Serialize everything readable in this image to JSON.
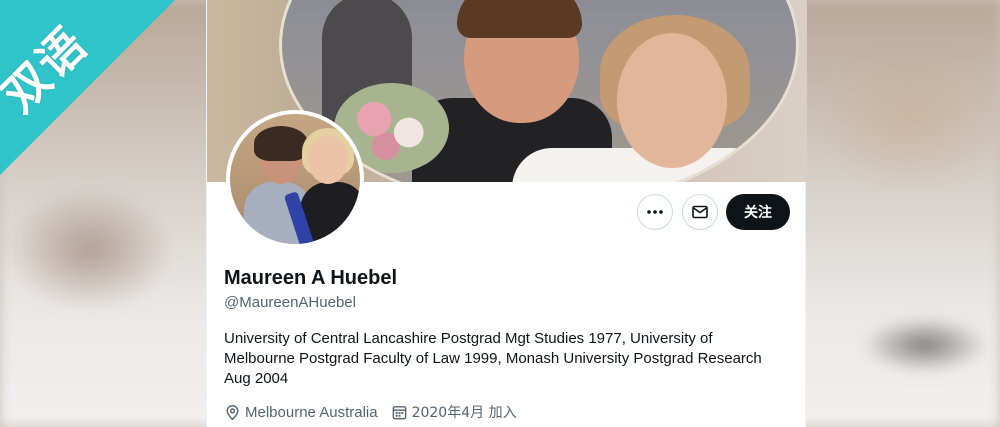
{
  "watermark": {
    "text": "双语"
  },
  "profile": {
    "name": "Maureen A Huebel",
    "handle": "@MaureenAHuebel",
    "bio": "University of Central Lancashire Postgrad Mgt Studies 1977, University of Melbourne Postgrad Faculty of Law 1999, Monash University Postgrad Research Aug 2004",
    "location": "Melbourne Australia",
    "joined": "2020年4月 加入"
  },
  "actions": {
    "more_icon": "more-horizontal-icon",
    "message_icon": "envelope-icon",
    "follow_label": "关注"
  },
  "colors": {
    "badge": "#2ec4c9",
    "follow_button": "#0f1419",
    "secondary_text": "#536471"
  }
}
